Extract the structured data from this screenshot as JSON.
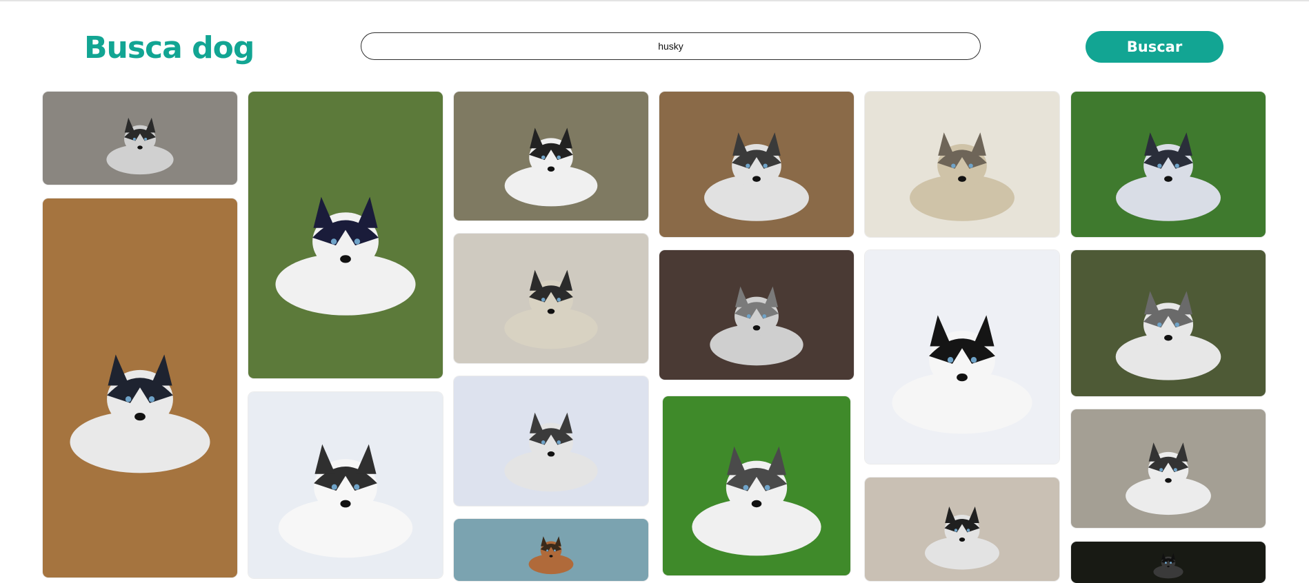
{
  "header": {
    "logo_text": "Busca dog",
    "search_value": "husky",
    "search_button_label": "Buscar"
  },
  "colors": {
    "accent": "#12a593"
  },
  "gallery": {
    "tiles": [
      {
        "name": "husky-photo-1",
        "bg": "#8a8680",
        "dog": "#d0d0d0",
        "mark": "#2a2a2a"
      },
      {
        "name": "husky-photo-2",
        "bg": "#a5743f",
        "dog": "#e9e9e9",
        "mark": "#1e2330"
      },
      {
        "name": "husky-photo-3",
        "bg": "#5c7a3a",
        "dog": "#f1f1f1",
        "mark": "#1a1c3a"
      },
      {
        "name": "husky-photo-4",
        "bg": "#e9edf3",
        "dog": "#f7f7f7",
        "mark": "#2f2f2f"
      },
      {
        "name": "husky-photo-5",
        "bg": "#7f7a62",
        "dog": "#f0f0f0",
        "mark": "#222222"
      },
      {
        "name": "husky-photo-6",
        "bg": "#cfcac0",
        "dog": "#d8d2c2",
        "mark": "#2b2b2b"
      },
      {
        "name": "husky-photo-7",
        "bg": "#dde2ee",
        "dog": "#e4e4e4",
        "mark": "#3b3b3b"
      },
      {
        "name": "husky-photo-8",
        "bg": "#7ba3b0",
        "dog": "#b06a3a",
        "mark": "#3a2a1a"
      },
      {
        "name": "husky-photo-9",
        "bg": "#8a6a48",
        "dog": "#e1e1e1",
        "mark": "#3a3a3a"
      },
      {
        "name": "husky-photo-10",
        "bg": "#4a3a34",
        "dog": "#cfcfcf",
        "mark": "#7a7a7a"
      },
      {
        "name": "husky-photo-11",
        "bg": "#3f8a2a",
        "dog": "#f0f0f0",
        "mark": "#4a4a4a"
      },
      {
        "name": "husky-photo-12",
        "bg": "#e7e3d8",
        "dog": "#cfc3a8",
        "mark": "#6e6558"
      },
      {
        "name": "husky-photo-13",
        "bg": "#eef0f5",
        "dog": "#f6f6f6",
        "mark": "#151515"
      },
      {
        "name": "husky-photo-14",
        "bg": "#c9c0b4",
        "dog": "#e3e3e3",
        "mark": "#202020"
      },
      {
        "name": "husky-photo-15",
        "bg": "#3f7a2e",
        "dog": "#d9dde6",
        "mark": "#2a2e3a"
      },
      {
        "name": "husky-photo-16",
        "bg": "#4e5a36",
        "dog": "#e7e7e7",
        "mark": "#6a6a6a"
      },
      {
        "name": "husky-photo-17",
        "bg": "#a49f94",
        "dog": "#ececec",
        "mark": "#333333"
      },
      {
        "name": "husky-photo-18",
        "bg": "#181a14",
        "dog": "#3a3a3a",
        "mark": "#101010"
      }
    ]
  }
}
